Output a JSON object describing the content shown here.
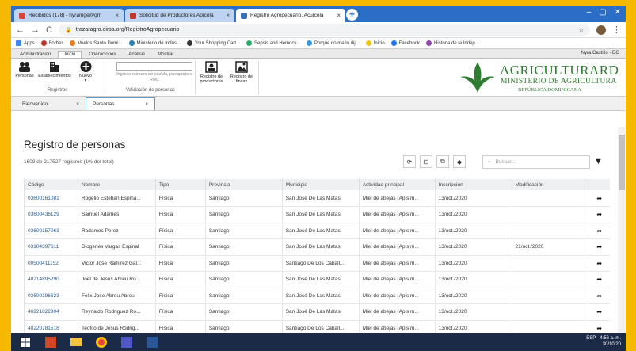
{
  "browser": {
    "tabs": [
      {
        "label": "Recibidos (178) - nyramge@gm",
        "color": "#d44638"
      },
      {
        "label": "Solicitud de Productores Apícola",
        "color": "#c0392b"
      },
      {
        "label": "Registro Agropecuario, Acuícola",
        "color": "#2e7d32"
      }
    ],
    "url": "trazaragro.oirsa.org/RegistroAgropecuario"
  },
  "bookmarks": [
    "Apps",
    "Forbes",
    "Vuelos Santo Domi...",
    "Ministerio de Indus...",
    "Your Shopping Cart...",
    "Sepsis and Hemocy...",
    "Porque no me lo dij...",
    "Inicio",
    "Facebook",
    "Historia de la Indep..."
  ],
  "ribbon": {
    "tabs": [
      "Administración",
      "Inicio",
      "Operaciones",
      "Análisis",
      "Mostrar"
    ],
    "user": "Nyra Castillo - DO",
    "buttons": {
      "personas": "Personas",
      "establecimientos": "Establecimientos",
      "nuevo": "Nuevo",
      "registro_productores": "Registro de productores",
      "registro_fincas": "Registro de fincas"
    },
    "group_registros": "Registros",
    "group_validacion": "Validación de personas",
    "cedula_placeholder": "Ingrese número de cédula, pasaporte o RNC"
  },
  "logo": {
    "line1": "AGRICULTURARD",
    "line2": "MINISTERIO DE AGRICULTURA",
    "line3": "REPÚBLICA DOMINICANA"
  },
  "pagetabs": [
    "Bienvenido",
    "Personas"
  ],
  "main": {
    "title": "Registro de personas",
    "subtitle": "1609 de 217527 registros (1% del total)",
    "search_placeholder": "Buscar..."
  },
  "table": {
    "headers": [
      "Código",
      "Nombre",
      "Tipo",
      "Provincia",
      "Municipio",
      "Actividad principal",
      "Inscripción",
      "Modificación",
      ""
    ],
    "rows": [
      [
        "03600161081",
        "Rogelio Esteban Espina...",
        "Física",
        "Santiago",
        "San José De Las Matas",
        "Miel de abejas (Apis m...",
        "13/oct./2020",
        ""
      ],
      [
        "03600436129",
        "Samuel Adames",
        "Física",
        "Santiago",
        "San José De Las Matas",
        "Miel de abejas (Apis m...",
        "13/oct./2020",
        ""
      ],
      [
        "03600157063",
        "Radames Perez",
        "Física",
        "Santiago",
        "San José De Las Matas",
        "Miel de abejas (Apis m...",
        "13/oct./2020",
        ""
      ],
      [
        "03104397611",
        "Diogenes Vargas Espinal",
        "Física",
        "Santiago",
        "San José De Las Matas",
        "Miel de abejas (Apis m...",
        "13/oct./2020",
        "21/oct./2020"
      ],
      [
        "00500411152",
        "Victor Jose Ramirez Gal...",
        "Física",
        "Santiago",
        "Santiago De Los Caball...",
        "Miel de abejas (Apis m...",
        "13/oct./2020",
        ""
      ],
      [
        "40214895290",
        "Joel de Jesus Abreu Ro...",
        "Física",
        "Santiago",
        "San José De Las Matas",
        "Miel de abejas (Apis m...",
        "13/oct./2020",
        ""
      ],
      [
        "03600196623",
        "Felix Jose Abreu Abreu",
        "Física",
        "Santiago",
        "San José De Las Matas",
        "Miel de abejas (Apis m...",
        "13/oct./2020",
        ""
      ],
      [
        "40221022904",
        "Reynaldo Rodriguez Ro...",
        "Física",
        "Santiago",
        "San José De Las Matas",
        "Miel de abejas (Apis m...",
        "13/oct./2020",
        ""
      ],
      [
        "40220781518",
        "Teofilo de Jesus Rodrig...",
        "Física",
        "Santiago",
        "Santiago De Los Caball...",
        "Miel de abejas (Apis m...",
        "13/oct./2020",
        ""
      ]
    ]
  },
  "taskbar": {
    "lang": "ESP",
    "time": "4:56 a. m.",
    "date": "30/10/20"
  }
}
